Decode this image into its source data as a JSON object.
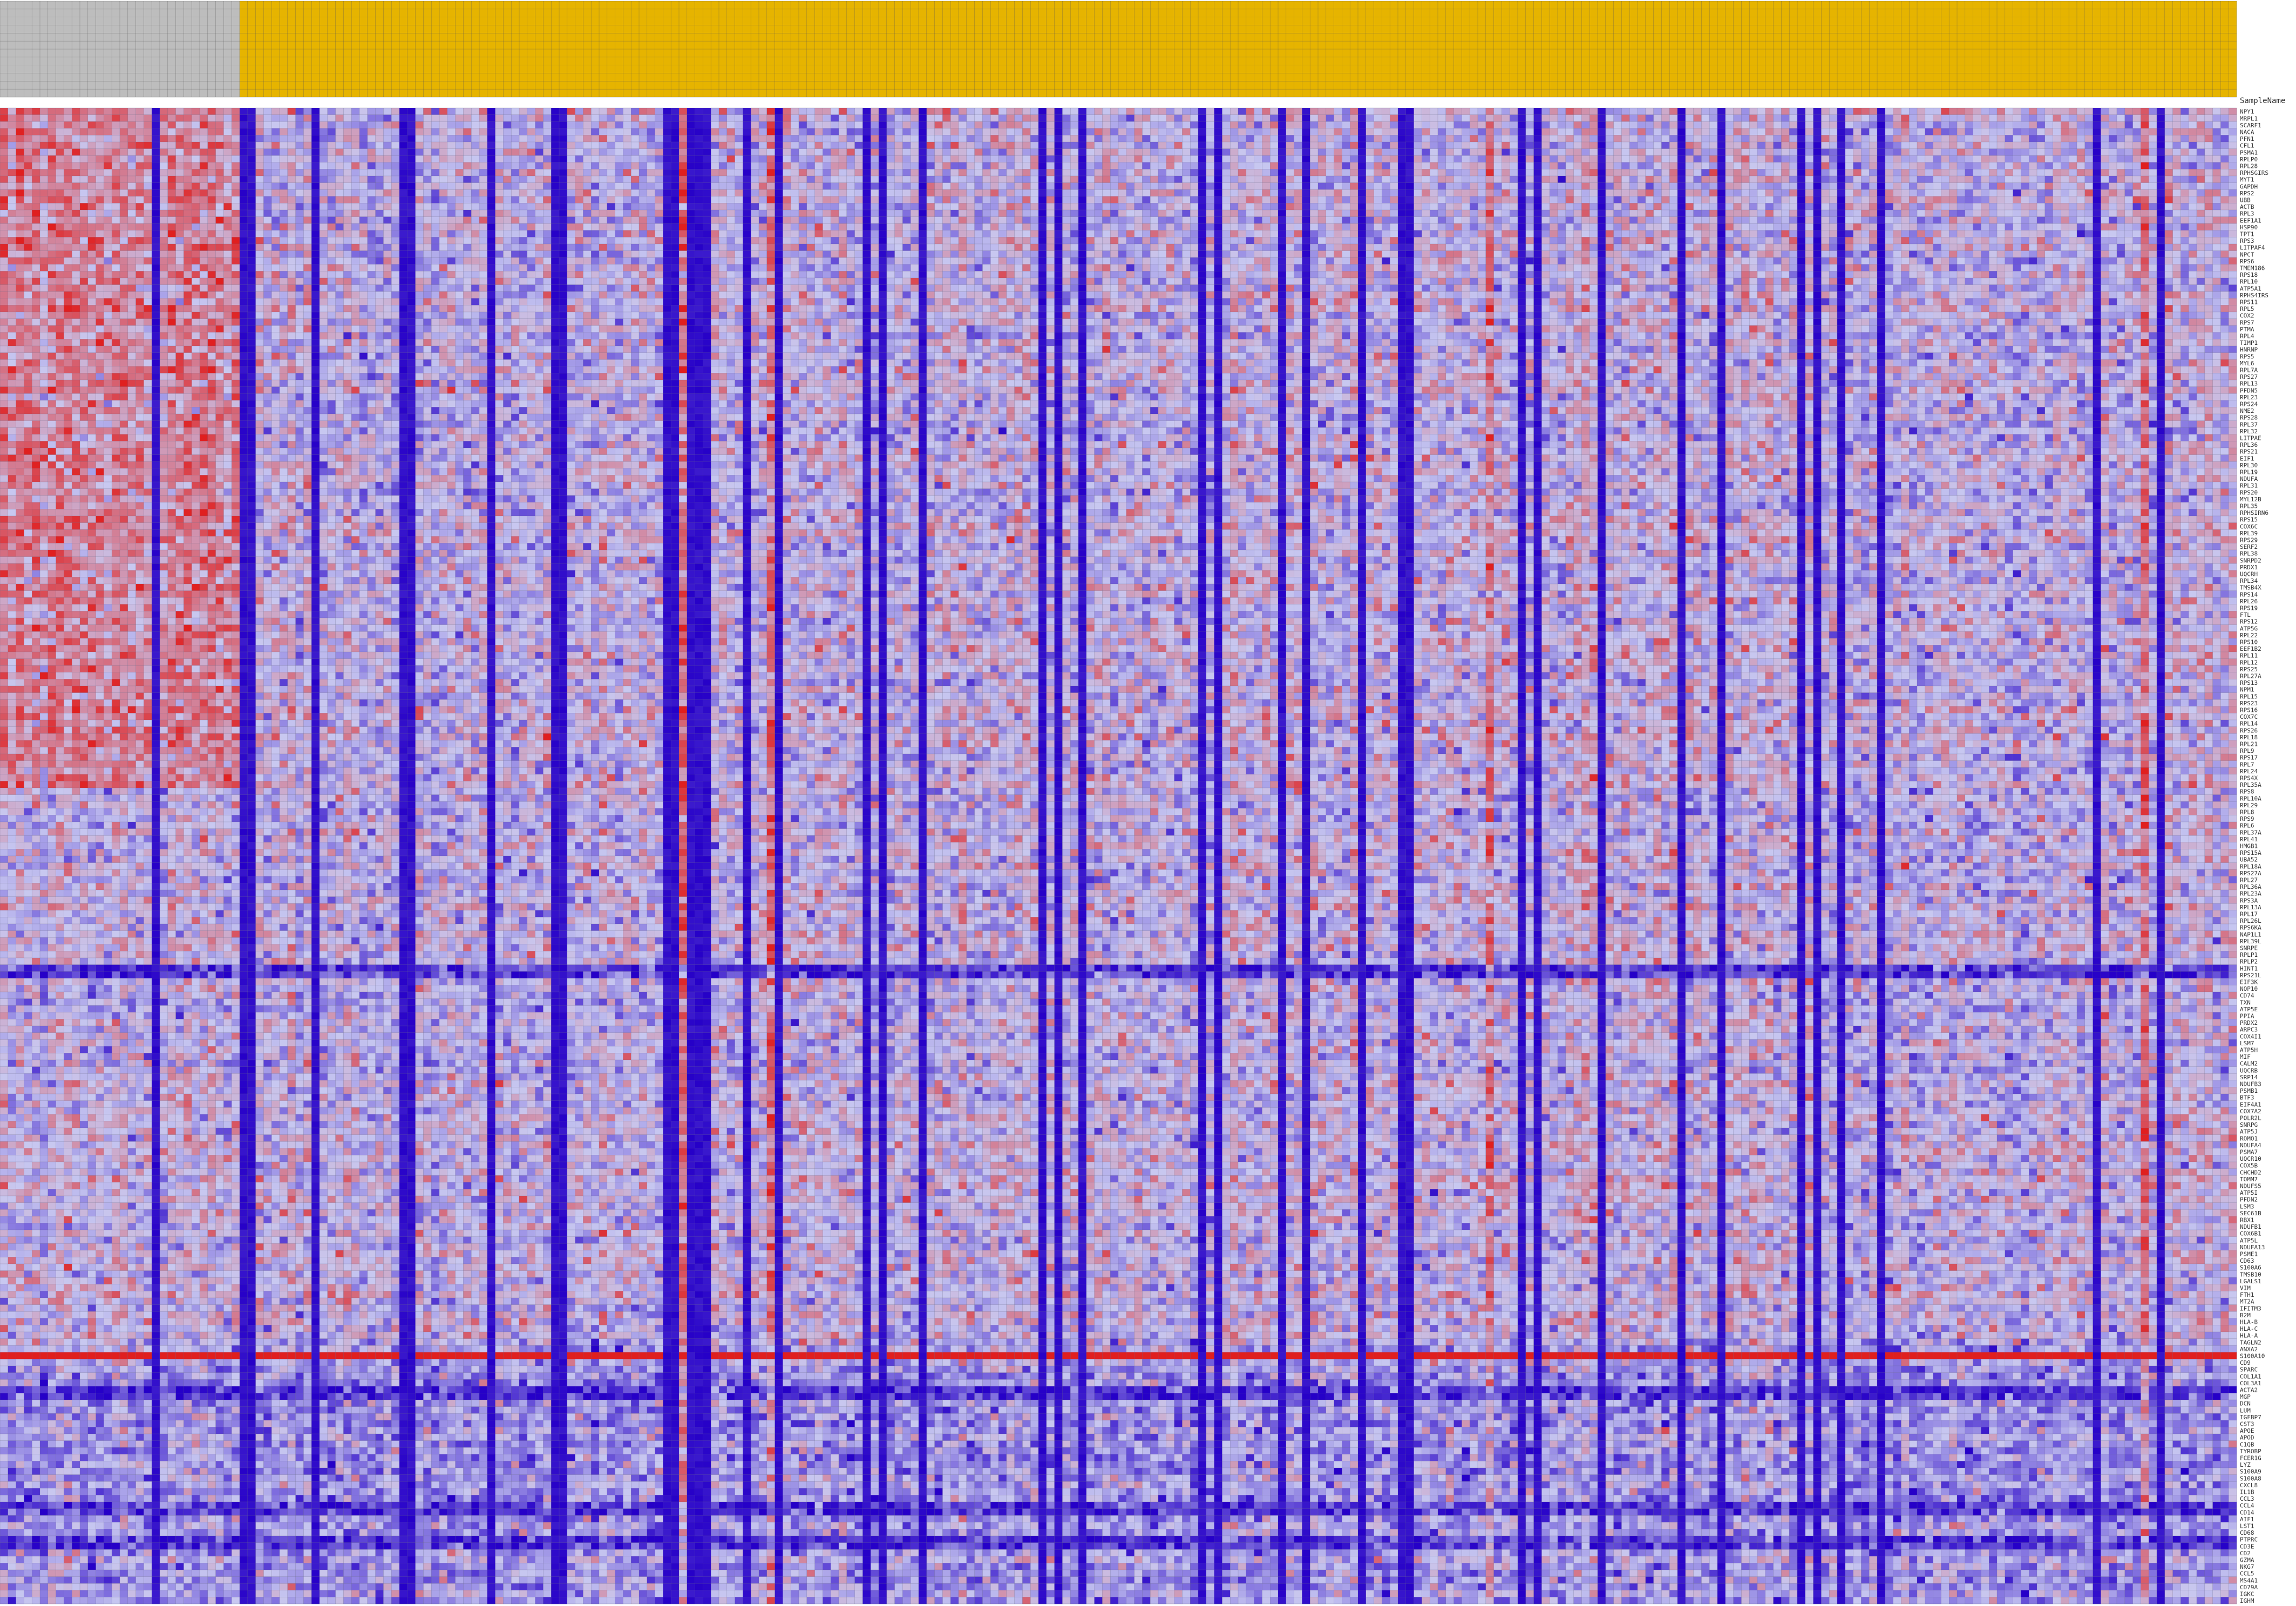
{
  "chart_data": {
    "type": "heatmap",
    "title": "",
    "xlabel": "",
    "ylabel": "",
    "sample_label": "SampleName",
    "n_samples": 280,
    "n_genes": 220,
    "header_colors": {
      "gray_group": "#bdbdbd",
      "gold_group": "#e6b400"
    },
    "header_groups": [
      {
        "color": "gray",
        "samples": 30
      },
      {
        "color": "gold",
        "samples": 250
      }
    ],
    "color_scale": {
      "low": "#2600c8",
      "mid": "#c8c8f0",
      "high": "#e01f1f"
    },
    "value_range": [
      -3,
      3
    ],
    "legend": false,
    "grid": true,
    "row_labels": [
      "NPY1",
      "MRPL1",
      "SCARF1",
      "NACA",
      "PFN1",
      "CFL1",
      "PSMA1",
      "RPLP0",
      "RPL28",
      "RPHSGIRS",
      "MYT1",
      "GAPDH",
      "RPS2",
      "UBB",
      "ACTB",
      "RPL3",
      "EEF1A1",
      "HSP90",
      "TPT1",
      "RPS3",
      "LITPAF4",
      "NPCT",
      "RPS6",
      "TMEM186",
      "RPS18",
      "RPL10",
      "ATP5A1",
      "RPHS4IRS",
      "RPS11",
      "RPL5",
      "COX2",
      "RPS7",
      "PTMA",
      "RPL4",
      "TIMP1",
      "HNRNP",
      "RPS5",
      "MYL6",
      "RPL7A",
      "RPS27",
      "RPL13",
      "PFDN5",
      "RPL23",
      "RPS24",
      "NME2",
      "RPS28",
      "RPL37",
      "RPL32",
      "LITPAE",
      "RPL36",
      "RPS21",
      "EIF1",
      "RPL30",
      "RPL19",
      "NDUFA",
      "RPL31",
      "RPS20",
      "MYL12B",
      "RPL35",
      "RPHSIRN6",
      "RPS15",
      "COX6C",
      "RPL39",
      "RPS29",
      "SERF2",
      "RPL38",
      "SNRPD2",
      "PRDX1",
      "UQCRH",
      "RPL34",
      "TMSB4X",
      "RPS14",
      "RPL26",
      "RPS19",
      "FTL",
      "RPS12",
      "ATP5G",
      "RPL22",
      "RPS10",
      "EEF1B2",
      "RPL11",
      "RPL12",
      "RPS25",
      "RPL27A",
      "RPS13",
      "NPM1",
      "RPL15",
      "RPS23",
      "RPS16",
      "COX7C",
      "RPL14",
      "RPS26",
      "RPL18",
      "RPL21",
      "RPL9",
      "RPS17",
      "RPL7",
      "RPL24",
      "RPS4X",
      "RPL35A",
      "RPS8",
      "RPL10A",
      "RPL29",
      "RPL8",
      "RPS9",
      "RPL6",
      "RPL37A",
      "RPL41",
      "HMGB1",
      "RPS15A",
      "UBA52",
      "RPL18A",
      "RPS27A",
      "RPL27",
      "RPL36A",
      "RPL23A",
      "RPS3A",
      "RPL13A",
      "RPL17",
      "RPL26L",
      "RPS6KA",
      "NAP1L1",
      "RPL39L",
      "SNRPE",
      "RPLP1",
      "RPLP2",
      "HINT1",
      "RPS21L",
      "EIF3K",
      "NOP10",
      "CD74",
      "TXN",
      "ATP5E",
      "PPIA",
      "PRDX2",
      "ARPC3",
      "COX4I1",
      "LSM7",
      "ATP5H",
      "MIF",
      "CALM2",
      "UQCRB",
      "SRP14",
      "NDUFB3",
      "PSMB1",
      "BTF3",
      "EIF4A1",
      "COX7A2",
      "POLR2L",
      "SNRPG",
      "ATP5J",
      "ROMO1",
      "NDUFA4",
      "PSMA7",
      "UQCR10",
      "COX5B",
      "CHCHD2",
      "TOMM7",
      "NDUFS5",
      "ATP5I",
      "PFDN2",
      "LSM3",
      "SEC61B",
      "RBX1",
      "NDUFB1",
      "COX6B1",
      "ATP5L",
      "NDUFA13",
      "PSME1",
      "CD63",
      "S100A6",
      "TMSB10",
      "LGALS1",
      "VIM",
      "FTH1",
      "MT2A",
      "IFITM3",
      "B2M",
      "HLA-B",
      "HLA-C",
      "HLA-A",
      "TAGLN2",
      "ANXA2",
      "S100A10",
      "CD9",
      "SPARC",
      "COL1A1",
      "COL3A1",
      "ACTA2",
      "MGP",
      "DCN",
      "LUM",
      "IGFBP7",
      "CST3",
      "APOE",
      "APOD",
      "C1QB",
      "TYROBP",
      "FCER1G",
      "LYZ",
      "S100A9",
      "S100A8",
      "CXCL8",
      "IL1B",
      "CCL3",
      "CCL4",
      "CD14",
      "AIF1",
      "LST1",
      "CD68",
      "PTPRC",
      "CD3E",
      "CD2",
      "GZMA",
      "NKG7",
      "CCL5",
      "MS4A1",
      "CD79A",
      "IGKC",
      "IGHM",
      "JCHAIN",
      "MZB1",
      "XBP1",
      "PLVAP",
      "VWF"
    ]
  }
}
